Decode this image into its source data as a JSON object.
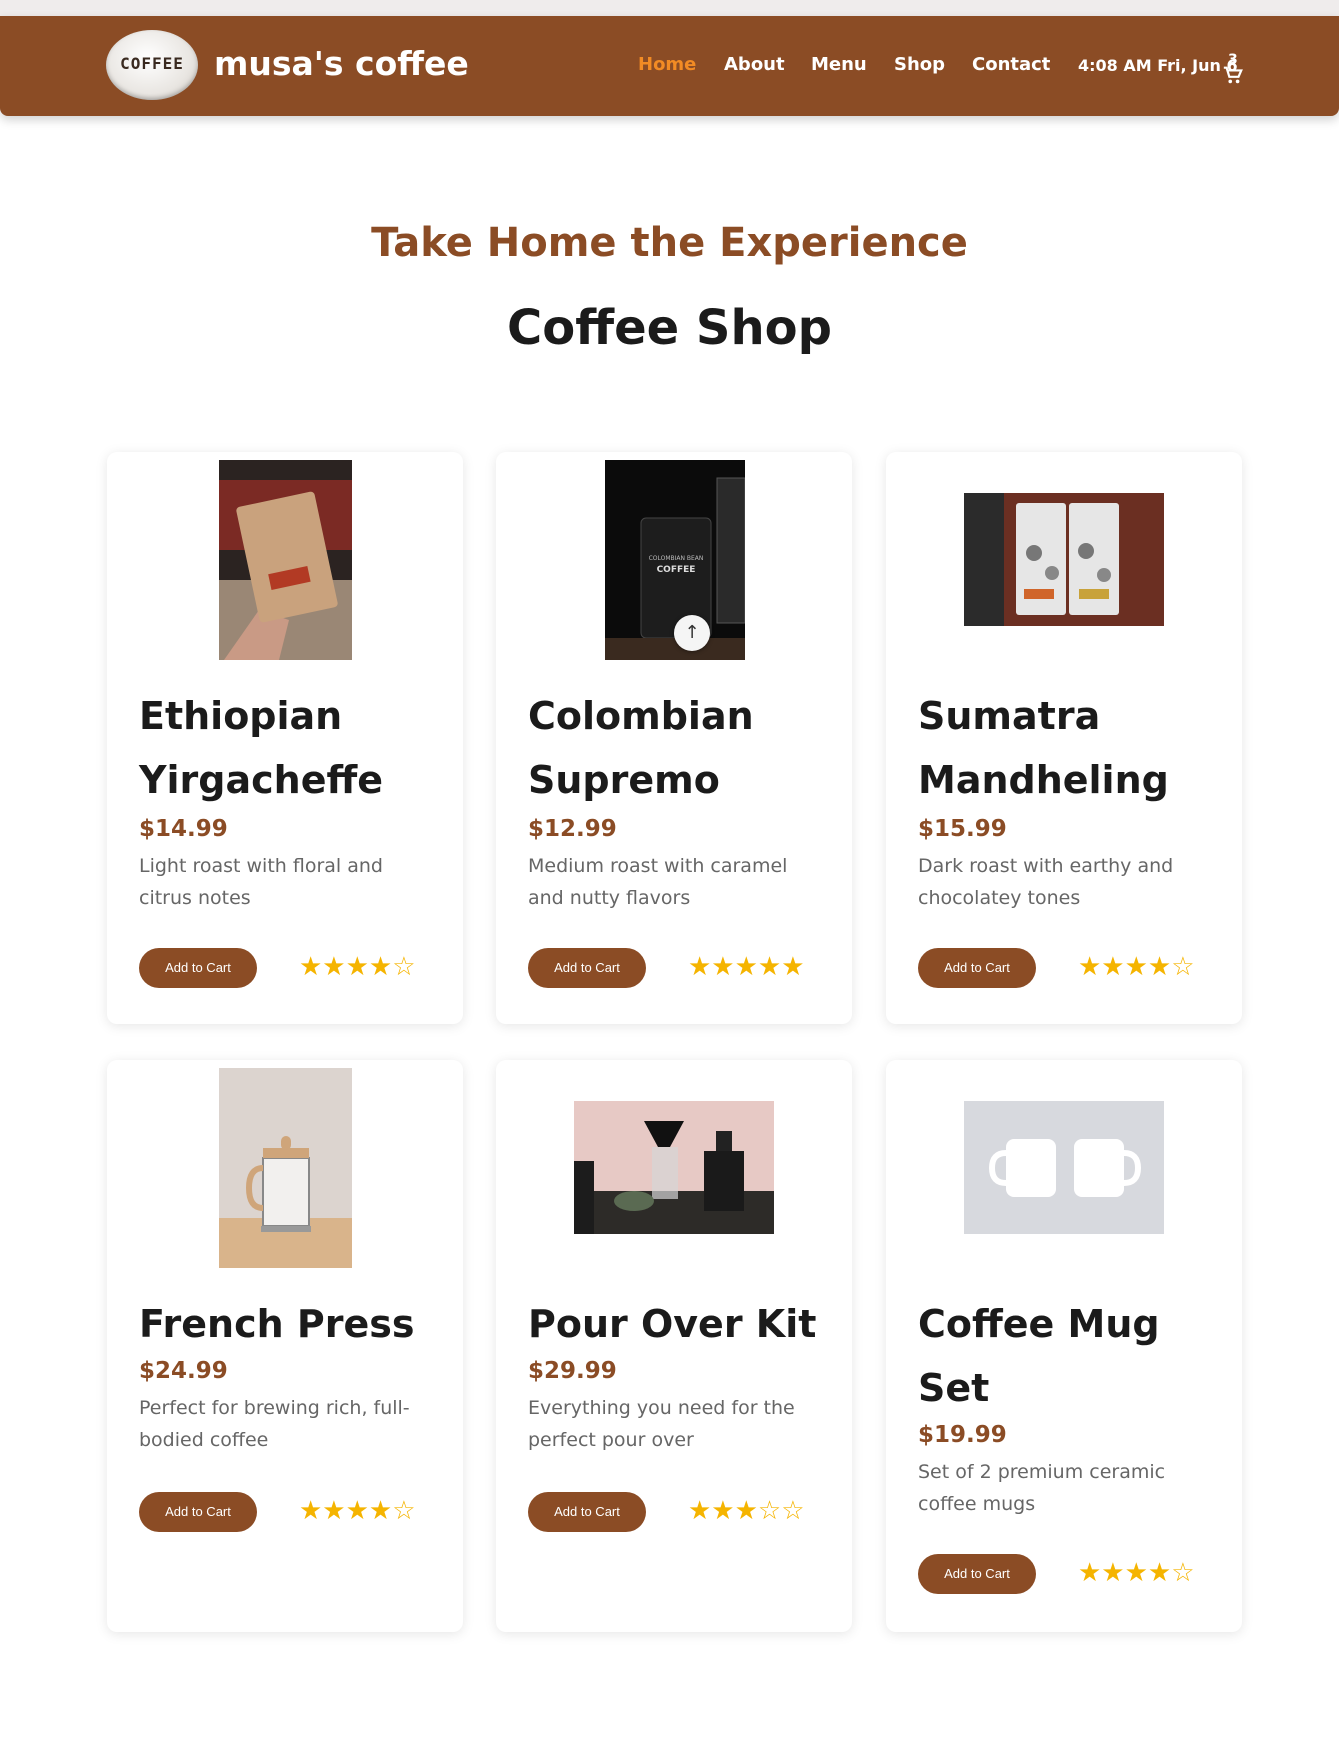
{
  "header": {
    "logo_text": "COFFEE",
    "brand": "musa's coffee",
    "nav": [
      "Home",
      "About",
      "Menu",
      "Shop",
      "Contact"
    ],
    "active": "Home",
    "datetime": "4:08 AM Fri, Jun 6",
    "cart_count": "3"
  },
  "hero": {
    "subtitle": "Take Home the Experience",
    "title": "Coffee Shop"
  },
  "products": [
    {
      "name": "Ethiopian Yirgacheffe",
      "price": "$14.99",
      "description": "Light roast with floral and citrus notes",
      "button": "Add to Cart",
      "stars": "★★★★☆",
      "rating": 4
    },
    {
      "name": "Colombian Supremo",
      "price": "$12.99",
      "description": "Medium roast with caramel and nutty flavors",
      "button": "Add to Cart",
      "stars": "★★★★★",
      "rating": 5
    },
    {
      "name": "Sumatra Mandheling",
      "price": "$15.99",
      "description": "Dark roast with earthy and chocolatey tones",
      "button": "Add to Cart",
      "stars": "★★★★☆",
      "rating": 4
    },
    {
      "name": "French Press",
      "price": "$24.99",
      "description": "Perfect for brewing rich, full-bodied coffee",
      "button": "Add to Cart",
      "stars": "★★★★☆",
      "rating": 4
    },
    {
      "name": "Pour Over Kit",
      "price": "$29.99",
      "description": "Everything you need for the perfect pour over",
      "button": "Add to Cart",
      "stars": "★★★☆☆",
      "rating": 3
    },
    {
      "name": "Coffee Mug Set",
      "price": "$19.99",
      "description": "Set of 2 premium ceramic coffee mugs",
      "button": "Add to Cart",
      "stars": "★★★★☆",
      "rating": 4
    }
  ],
  "images": {
    "image_1_label_1": "COLOMBIAN BEAN",
    "image_1_label_2": "COFFEE"
  },
  "colors": {
    "brand": "#8b4c25",
    "active_nav": "#f28b24",
    "star": "#f5b400"
  }
}
